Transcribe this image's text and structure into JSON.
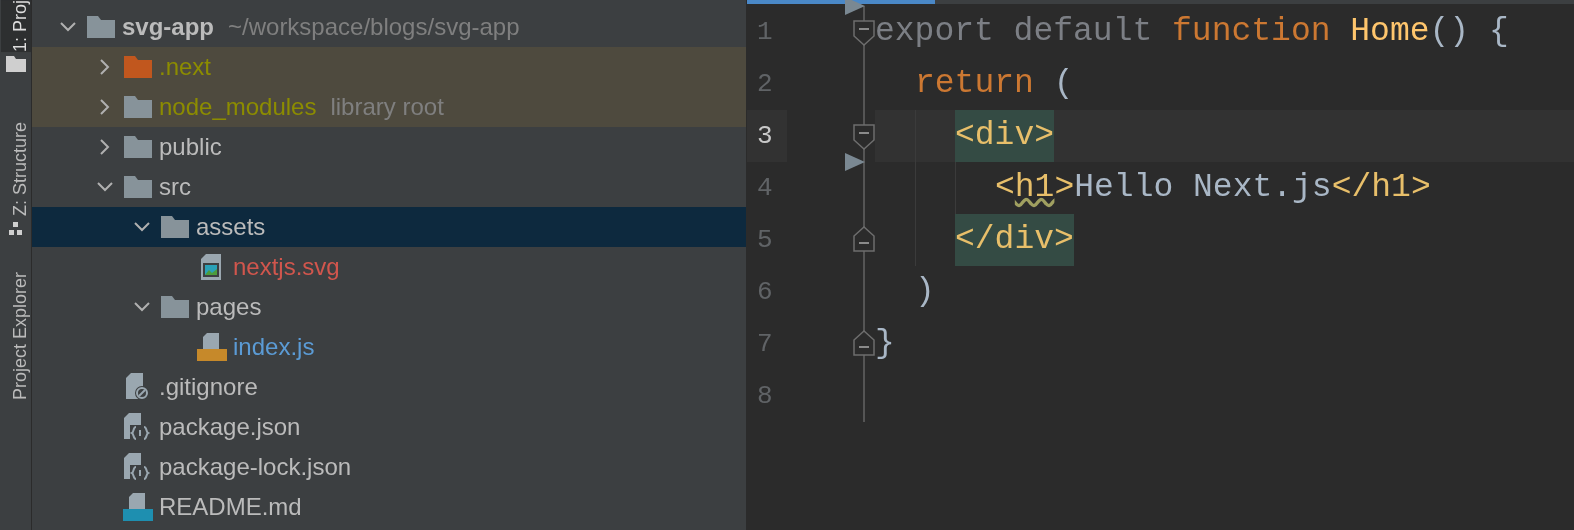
{
  "tool_strip": [
    {
      "label": "1: Proj",
      "selected": true
    },
    {
      "label": "Z: Structure",
      "selected": false
    },
    {
      "label": "Project Explorer",
      "selected": false
    }
  ],
  "project_tree": [
    {
      "kind": "project",
      "name": "svg-app",
      "hint": "~/workspace/blogs/svg-app",
      "color": "#bbbbbb",
      "expanded": true,
      "selected": false,
      "children": [
        {
          "kind": "excluded-folder",
          "name": ".next",
          "color": "#8c8c00",
          "ignored": true,
          "expanded": false,
          "selected": false
        },
        {
          "kind": "folder",
          "name": "node_modules",
          "hint": "library root",
          "color": "#8c8c00",
          "ignored": true,
          "expanded": false,
          "selected": false
        },
        {
          "kind": "folder",
          "name": "public",
          "color": "#bbbbbb",
          "expanded": false,
          "selected": false
        },
        {
          "kind": "folder",
          "name": "src",
          "color": "#bbbbbb",
          "expanded": true,
          "selected": false,
          "children": [
            {
              "kind": "folder",
              "name": "assets",
              "color": "#bbbbbb",
              "expanded": true,
              "selected": true,
              "children": [
                {
                  "kind": "image",
                  "name": "nextjs.svg",
                  "color": "#d1564d",
                  "selected": false
                }
              ]
            },
            {
              "kind": "folder",
              "name": "pages",
              "color": "#bbbbbb",
              "expanded": true,
              "selected": false,
              "children": [
                {
                  "kind": "js",
                  "name": "index.js",
                  "color": "#5b9bd5",
                  "selected": false
                }
              ]
            }
          ]
        },
        {
          "kind": "gitignore",
          "name": ".gitignore",
          "color": "#bbbbbb",
          "selected": false
        },
        {
          "kind": "json",
          "name": "package.json",
          "color": "#bbbbbb",
          "selected": false
        },
        {
          "kind": "json",
          "name": "package-lock.json",
          "color": "#bbbbbb",
          "selected": false
        },
        {
          "kind": "markdown",
          "name": "README.md",
          "color": "#bbbbbb",
          "selected": false
        }
      ]
    }
  ],
  "editor": {
    "lines": [
      {
        "number": "1",
        "fold_start": true,
        "marker": true,
        "current": false,
        "tokens": [
          {
            "kind": "modifier",
            "text": "export default "
          },
          {
            "kind": "keyword",
            "text": "function "
          },
          {
            "kind": "function",
            "text": "Home"
          },
          {
            "kind": "plain",
            "text": "() {"
          }
        ],
        "children": [
          {
            "number": "2",
            "current": false,
            "tokens": [
              {
                "kind": "keyword",
                "text": "return "
              },
              {
                "kind": "plain",
                "text": "("
              }
            ],
            "children": [
              {
                "number": "3",
                "fold_start": true,
                "current": true,
                "tokens": [
                  {
                    "kind": "matched-tag",
                    "text": "<div>"
                  }
                ],
                "children": [
                  {
                    "number": "4",
                    "marker": true,
                    "current": false,
                    "tokens": [
                      {
                        "kind": "tag",
                        "text": "<"
                      },
                      {
                        "kind": "warned-tag",
                        "text": "h1"
                      },
                      {
                        "kind": "tag",
                        "text": ">"
                      },
                      {
                        "kind": "plain",
                        "text": "Hello Next.js"
                      },
                      {
                        "kind": "tag",
                        "text": "</h1>"
                      }
                    ]
                  }
                ]
              },
              {
                "number": "5",
                "fold_end": true,
                "current": false,
                "tokens": [
                  {
                    "kind": "matched-tag",
                    "text": "</div>"
                  }
                ]
              }
            ]
          },
          {
            "number": "6",
            "current": false,
            "tokens": [
              {
                "kind": "plain",
                "text": ")"
              }
            ]
          }
        ]
      },
      {
        "number": "7",
        "fold_end": true,
        "current": false,
        "tokens": [
          {
            "kind": "plain",
            "text": "}"
          }
        ]
      },
      {
        "number": "8",
        "current": false
      }
    ]
  }
}
